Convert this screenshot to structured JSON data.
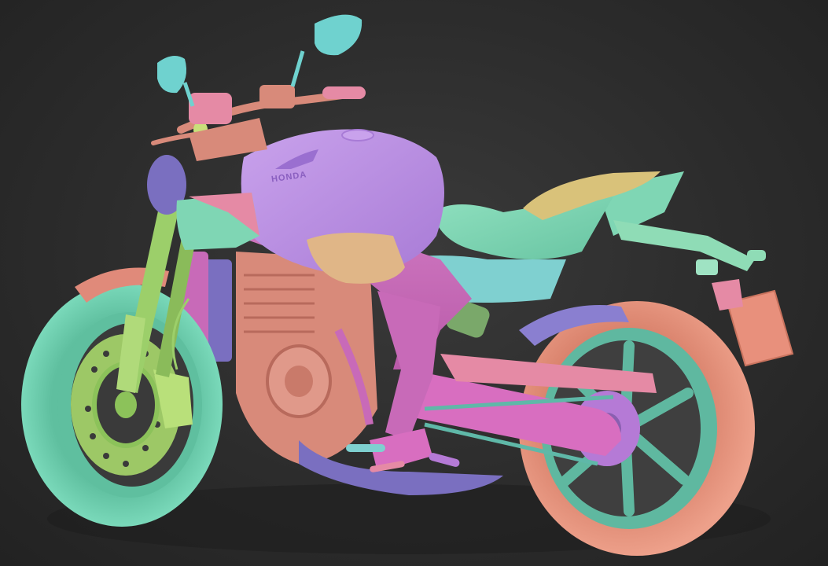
{
  "scene": {
    "subject": "motorcycle-3d-model",
    "tank_logo_text": "HONDA"
  },
  "colors": {
    "background": "#2c2c2c",
    "tire_teal": "#6fcfb0",
    "tire_teal_dark": "#4fae93",
    "tire_salmon": "#e8937c",
    "tire_salmon_dark": "#c9735e",
    "tank_violet": "#b98be0",
    "tank_violet_light": "#c9a2ec",
    "frame_magenta": "#c86ab8",
    "engine_rose": "#d88a7a",
    "engine_rose_dark": "#b86a5c",
    "seat_mint": "#7fd6b4",
    "seat_tan": "#d9c27a",
    "panel_tan": "#e0b687",
    "fork_green": "#9ccf6a",
    "mirror_cyan": "#6fd2cf",
    "radiator_blue": "#7a6fc0",
    "fender_pink": "#e58aa5",
    "plate_salmon": "#e8907c",
    "disc_green": "#a8d86c",
    "swingarm_pink": "#d86ec0",
    "chain_teal": "#5fb8a8",
    "sprocket_violet": "#b57ad6"
  }
}
